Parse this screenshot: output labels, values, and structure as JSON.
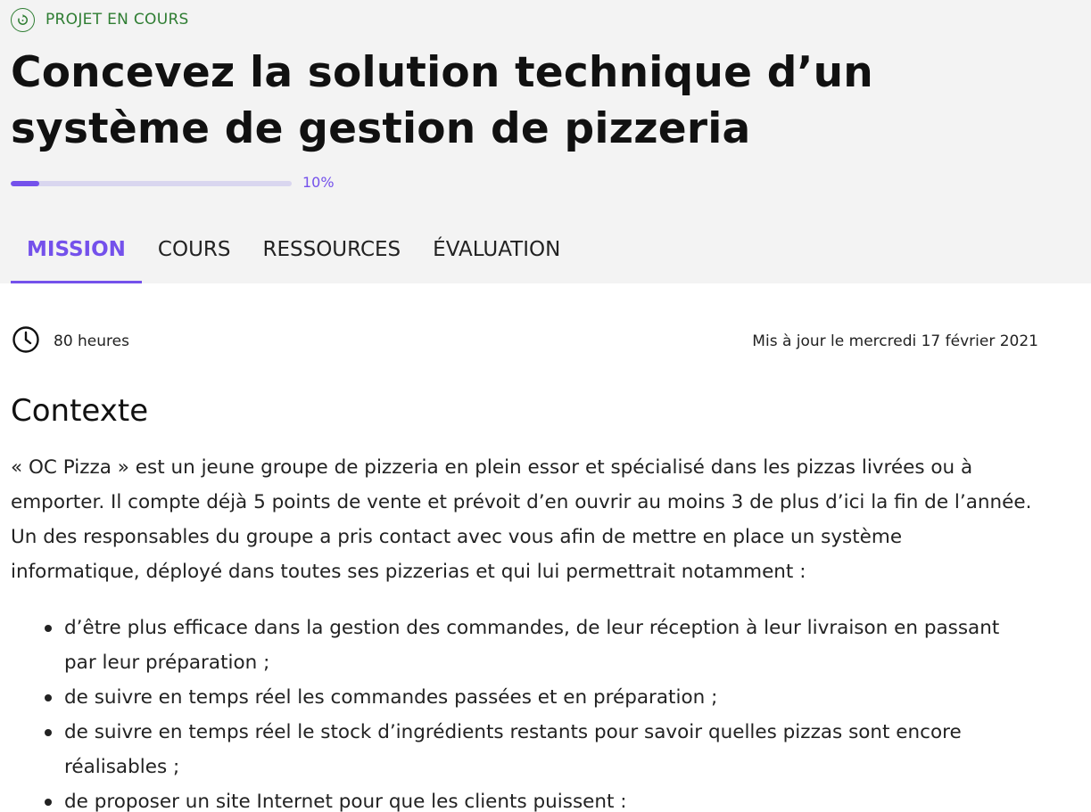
{
  "header": {
    "status": "PROJET EN COURS",
    "status_icon": "progress-cycle-icon",
    "title": "Concevez la solution technique d’un système de gestion de pizzeria",
    "progress_percent": 10,
    "progress_label": "10%",
    "accent_color": "#7451eb",
    "status_color": "#2e7d32"
  },
  "tabs": [
    {
      "label": "MISSION",
      "active": true
    },
    {
      "label": "COURS",
      "active": false
    },
    {
      "label": "RESSOURCES",
      "active": false
    },
    {
      "label": "ÉVALUATION",
      "active": false
    }
  ],
  "meta": {
    "duration_icon": "clock-icon",
    "duration": "80 heures",
    "updated": "Mis à jour le mercredi 17 février 2021"
  },
  "content": {
    "section_title": "Contexte",
    "paragraph": "« OC Pizza » est un jeune groupe de pizzeria en plein essor et spécialisé dans les pizzas livrées ou à emporter. Il compte déjà 5 points de vente et prévoit d’en ouvrir au moins 3 de plus d’ici la fin de l’année. Un des responsables du groupe a pris contact avec vous afin de mettre en place un système informatique, déployé dans toutes ses pizzerias et qui lui permettrait notamment :",
    "bullets": [
      "d’être plus efficace dans la gestion des commandes, de leur réception à leur livraison en passant par leur préparation ;",
      "de suivre en temps réel les commandes passées et en préparation ;",
      "de suivre en temps réel le stock d’ingrédients restants pour savoir quelles pizzas sont encore réalisables ;",
      "de proposer un site Internet pour que les clients puissent :"
    ]
  }
}
